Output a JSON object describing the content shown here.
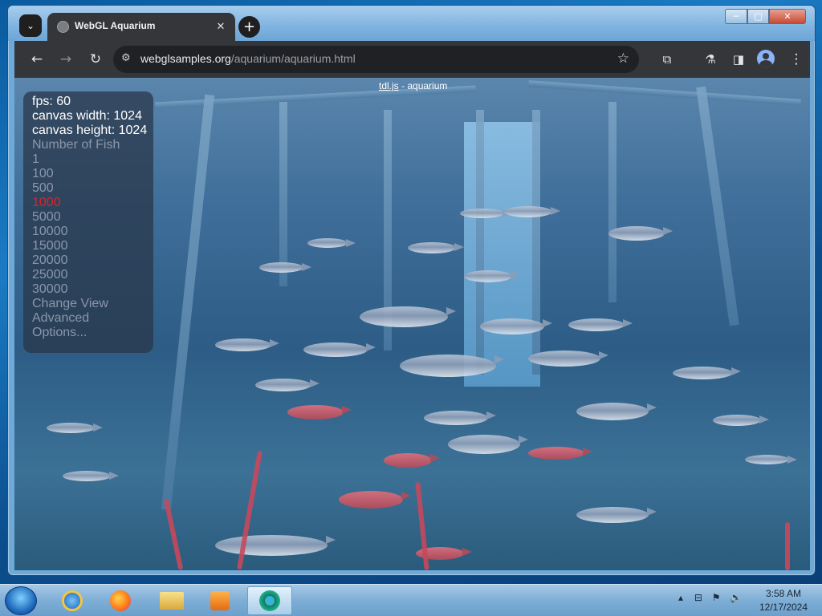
{
  "browser": {
    "tab_title": "WebGL Aquarium",
    "close_glyph": "✕",
    "new_tab_glyph": "+",
    "url_domain": "webglsamples.org",
    "url_path": "/aquarium/aquarium.html",
    "window_controls": {
      "minimize": "─",
      "maximize": "□",
      "close": "✕"
    },
    "toolbar_icons": [
      "back-icon",
      "forward-icon",
      "reload-icon",
      "site-settings-icon",
      "bookmark-star-icon",
      "extensions-icon",
      "labs-flask-icon",
      "side-panel-icon",
      "profile-avatar-icon",
      "menu-kebab-icon"
    ]
  },
  "scene": {
    "title_link": "tdl.js",
    "title_rest": " - aquarium"
  },
  "panel": {
    "fps": "fps: 60",
    "canvas_width": "canvas width: 1024",
    "canvas_height": "canvas height: 1024",
    "number_of_fish_label": "Number of Fish",
    "fish_options": [
      "1",
      "100",
      "500",
      "1000",
      "5000",
      "10000",
      "15000",
      "20000",
      "25000",
      "30000"
    ],
    "selected_fish": "1000",
    "change_view": "Change View",
    "advanced": "Advanced",
    "options": "Options..."
  },
  "taskbar": {
    "apps": [
      "internet-explorer-icon",
      "firefox-icon",
      "file-explorer-icon",
      "media-player-icon",
      "chrome-active-icon"
    ],
    "time": "3:58 AM",
    "date": "12/17/2024"
  },
  "colors": {
    "selected_option": "#e0202a",
    "panel_text": "#ffffff",
    "panel_option": "#8a97aa",
    "water": "#3f6f9a"
  }
}
